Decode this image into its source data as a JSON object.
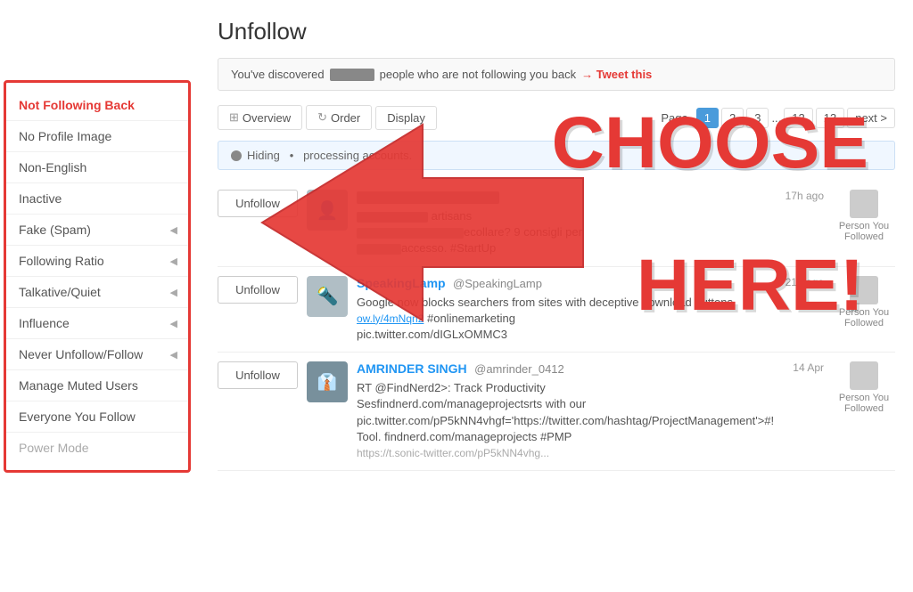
{
  "page": {
    "title": "Unfollow",
    "discovery_text_pre": "You've discovered",
    "discovery_text_post": "people who are not following you back",
    "tweet_link": "→ Tweet this"
  },
  "sidebar": {
    "items": [
      {
        "id": "not-following-back",
        "label": "Not Following Back",
        "icon": "👥",
        "active": true,
        "chevron": false
      },
      {
        "id": "no-profile-image",
        "label": "No Profile Image",
        "icon": "🖼",
        "active": false,
        "chevron": false
      },
      {
        "id": "non-english",
        "label": "Non-English",
        "icon": "💬",
        "active": false,
        "chevron": false
      },
      {
        "id": "inactive",
        "label": "Inactive",
        "icon": "⊗",
        "active": false,
        "chevron": false
      },
      {
        "id": "fake-spam",
        "label": "Fake (Spam)",
        "icon": "",
        "active": false,
        "chevron": true
      },
      {
        "id": "following-ratio",
        "label": "Following Ratio",
        "icon": "",
        "active": false,
        "chevron": true
      },
      {
        "id": "talkative-quiet",
        "label": "Talkative/Quiet",
        "icon": "",
        "active": false,
        "chevron": true
      },
      {
        "id": "influence",
        "label": "Influence",
        "icon": "",
        "active": false,
        "chevron": true
      },
      {
        "id": "never-unfollow",
        "label": "Never Unfollow/Follow",
        "icon": "",
        "active": false,
        "chevron": true
      },
      {
        "id": "manage-muted",
        "label": "Manage Muted Users",
        "icon": "🔇",
        "active": false,
        "chevron": false
      },
      {
        "id": "everyone-you-follow",
        "label": "Everyone You Follow",
        "icon": "👤",
        "active": false,
        "chevron": false
      },
      {
        "id": "power-mode",
        "label": "Power Mode",
        "icon": "✈",
        "active": false,
        "chevron": false,
        "disabled": true
      }
    ]
  },
  "toolbar": {
    "overview_label": "Overview",
    "order_label": "Order",
    "display_label": "Display"
  },
  "pagination": {
    "label": "Page",
    "pages": [
      "1",
      "2",
      "3",
      "...",
      "12",
      "13"
    ],
    "next_label": "next >"
  },
  "processing": {
    "text": "Hiding   .   r processing accounts."
  },
  "users": [
    {
      "name": "SpeakingLamp",
      "handle": "@SpeakingLamp",
      "time": "21h ago",
      "tweet": "Google now blocks searchers from sites with deceptive download buttons.\now.ly/4mNqn2 #onlinemarketing\npic.twitter.com/dIGLxOMMC3",
      "relation": "Person You\nFollowed",
      "has_avatar": false
    },
    {
      "name": "AMRINDER SINGH",
      "handle": "@amrinder_0412",
      "time": "14 Apr",
      "tweet": "RT @FindNerd2>: Track Productivity\nSesfindnerd.com/manageprojectsrts with our\npic.twitter.com/pP5kNN4vhgf='https://twitter.com/hashtag/ProjectManagement'>#!\nTool. findnerd.com/manageprojects #PMP",
      "relation": "Person You\nFollowed",
      "has_avatar": true
    }
  ],
  "overlay": {
    "choose_text": "CHOOSE",
    "here_text": "HERE!"
  }
}
